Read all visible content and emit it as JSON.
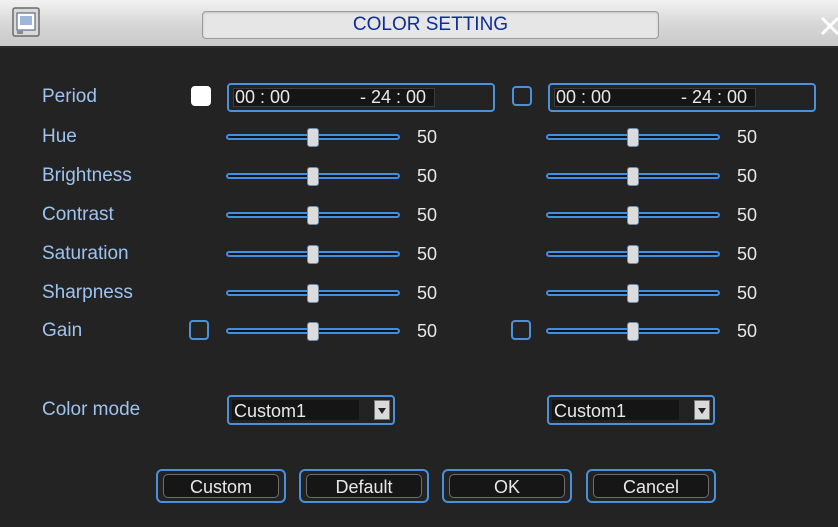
{
  "window": {
    "title": "COLOR SETTING"
  },
  "period": {
    "label": "Period",
    "col1": {
      "checked": true,
      "start": "00 : 00",
      "end": "- 24 : 00"
    },
    "col2": {
      "checked": false,
      "start": "00 : 00",
      "end": "- 24 : 00"
    }
  },
  "rows": [
    {
      "label": "Hue",
      "col1": 50,
      "col2": 50
    },
    {
      "label": "Brightness",
      "col1": 50,
      "col2": 50
    },
    {
      "label": "Contrast",
      "col1": 50,
      "col2": 50
    },
    {
      "label": "Saturation",
      "col1": 50,
      "col2": 50
    },
    {
      "label": "Sharpness",
      "col1": 50,
      "col2": 50
    },
    {
      "label": "Gain",
      "col1": 50,
      "col2": 50,
      "col1_checked": false,
      "col2_checked": false
    }
  ],
  "color_mode": {
    "label": "Color mode",
    "col1": "Custom1",
    "col2": "Custom1"
  },
  "buttons": {
    "custom": "Custom",
    "default": "Default",
    "ok": "OK",
    "cancel": "Cancel"
  },
  "colors": {
    "accent": "#4a90dc",
    "label": "#9ec3ee",
    "title": "#0d2d9a",
    "background": "#232323"
  }
}
